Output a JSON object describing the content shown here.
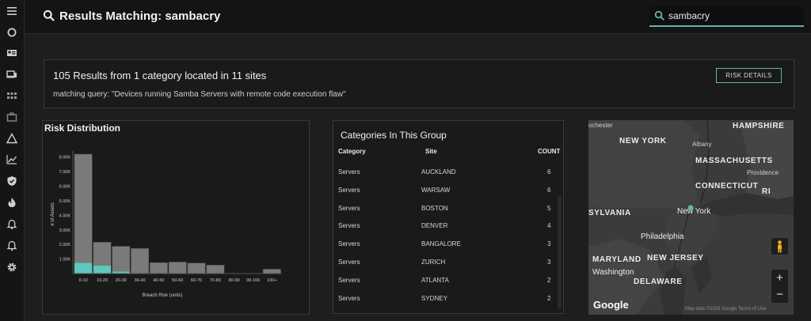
{
  "header": {
    "title": "Results Matching: sambacry",
    "search_value": "sambacry"
  },
  "summary": {
    "title": "105 Results from 1 category located in 11 sites",
    "query": "matching query: \"Devices running Samba Servers with remote code execution flaw\"",
    "button_label": "RISK DETAILS"
  },
  "risk_chart": {
    "panel_title": "Risk Distribution"
  },
  "categories": {
    "title": "Categories In This Group",
    "columns": [
      "Category",
      "Site",
      "COUNT"
    ],
    "rows": [
      {
        "category": "Servers",
        "site": "AUCKLAND",
        "count": "6"
      },
      {
        "category": "Servers",
        "site": "WARSAW",
        "count": "6"
      },
      {
        "category": "Servers",
        "site": "BOSTON",
        "count": "5"
      },
      {
        "category": "Servers",
        "site": "DENVER",
        "count": "4"
      },
      {
        "category": "Servers",
        "site": "BANGALORE",
        "count": "3"
      },
      {
        "category": "Servers",
        "site": "ZURICH",
        "count": "3"
      },
      {
        "category": "Servers",
        "site": "ATLANTA",
        "count": "2"
      },
      {
        "category": "Servers",
        "site": "SYDNEY",
        "count": "2"
      }
    ]
  },
  "map": {
    "labels": {
      "rochester": "ochester",
      "new_hampshire": "HAMPSHIRE",
      "new_york_state": "NEW YORK",
      "albany": "Albany",
      "massachusetts": "MASSACHUSETTS",
      "providence": "Providence",
      "connecticut": "CONNECTICUT",
      "rhode_island": "RI",
      "pennsylvania": "SYLVANIA",
      "new_york_city": "New York",
      "philadelphia": "Philadelphia",
      "maryland": "MARYLAND",
      "new_jersey": "NEW JERSEY",
      "washington": "Washington",
      "delaware": "DELAWARE"
    },
    "logo": "Google",
    "attribution": "Map data ©2019 Google    Terms of Use",
    "zoom_in": "+",
    "zoom_out": "−"
  },
  "colors": {
    "accent": "#5fb7b1",
    "bar": "#7a7a7a",
    "bar_highlight": "#5ec8c0",
    "map_bg": "#3b3b3b"
  },
  "chart_data": {
    "type": "bar",
    "title": "Risk Distribution",
    "xlabel": "Breach Risk (units)",
    "ylabel": "# of Assets",
    "categories": [
      "0-10",
      "10-20",
      "20-30",
      "30-40",
      "40-50",
      "50-60",
      "60-70",
      "70-80",
      "80-90",
      "90-100",
      "100+"
    ],
    "yticks": [
      1000,
      2000,
      3000,
      4000,
      5000,
      6000,
      7000,
      8000
    ],
    "ytick_labels": [
      "1.00K",
      "2.00K",
      "3.00K",
      "4.00K",
      "5.00K",
      "6.00K",
      "7.00K",
      "8.00K"
    ],
    "ylim": [
      0,
      8200
    ],
    "series": [
      {
        "values": [
          8200,
          2150,
          1870,
          1720,
          750,
          790,
          720,
          580,
          0,
          0,
          300
        ]
      },
      {
        "values": [
          730,
          540,
          130,
          0,
          0,
          0,
          0,
          0,
          0,
          0,
          0
        ]
      }
    ]
  }
}
